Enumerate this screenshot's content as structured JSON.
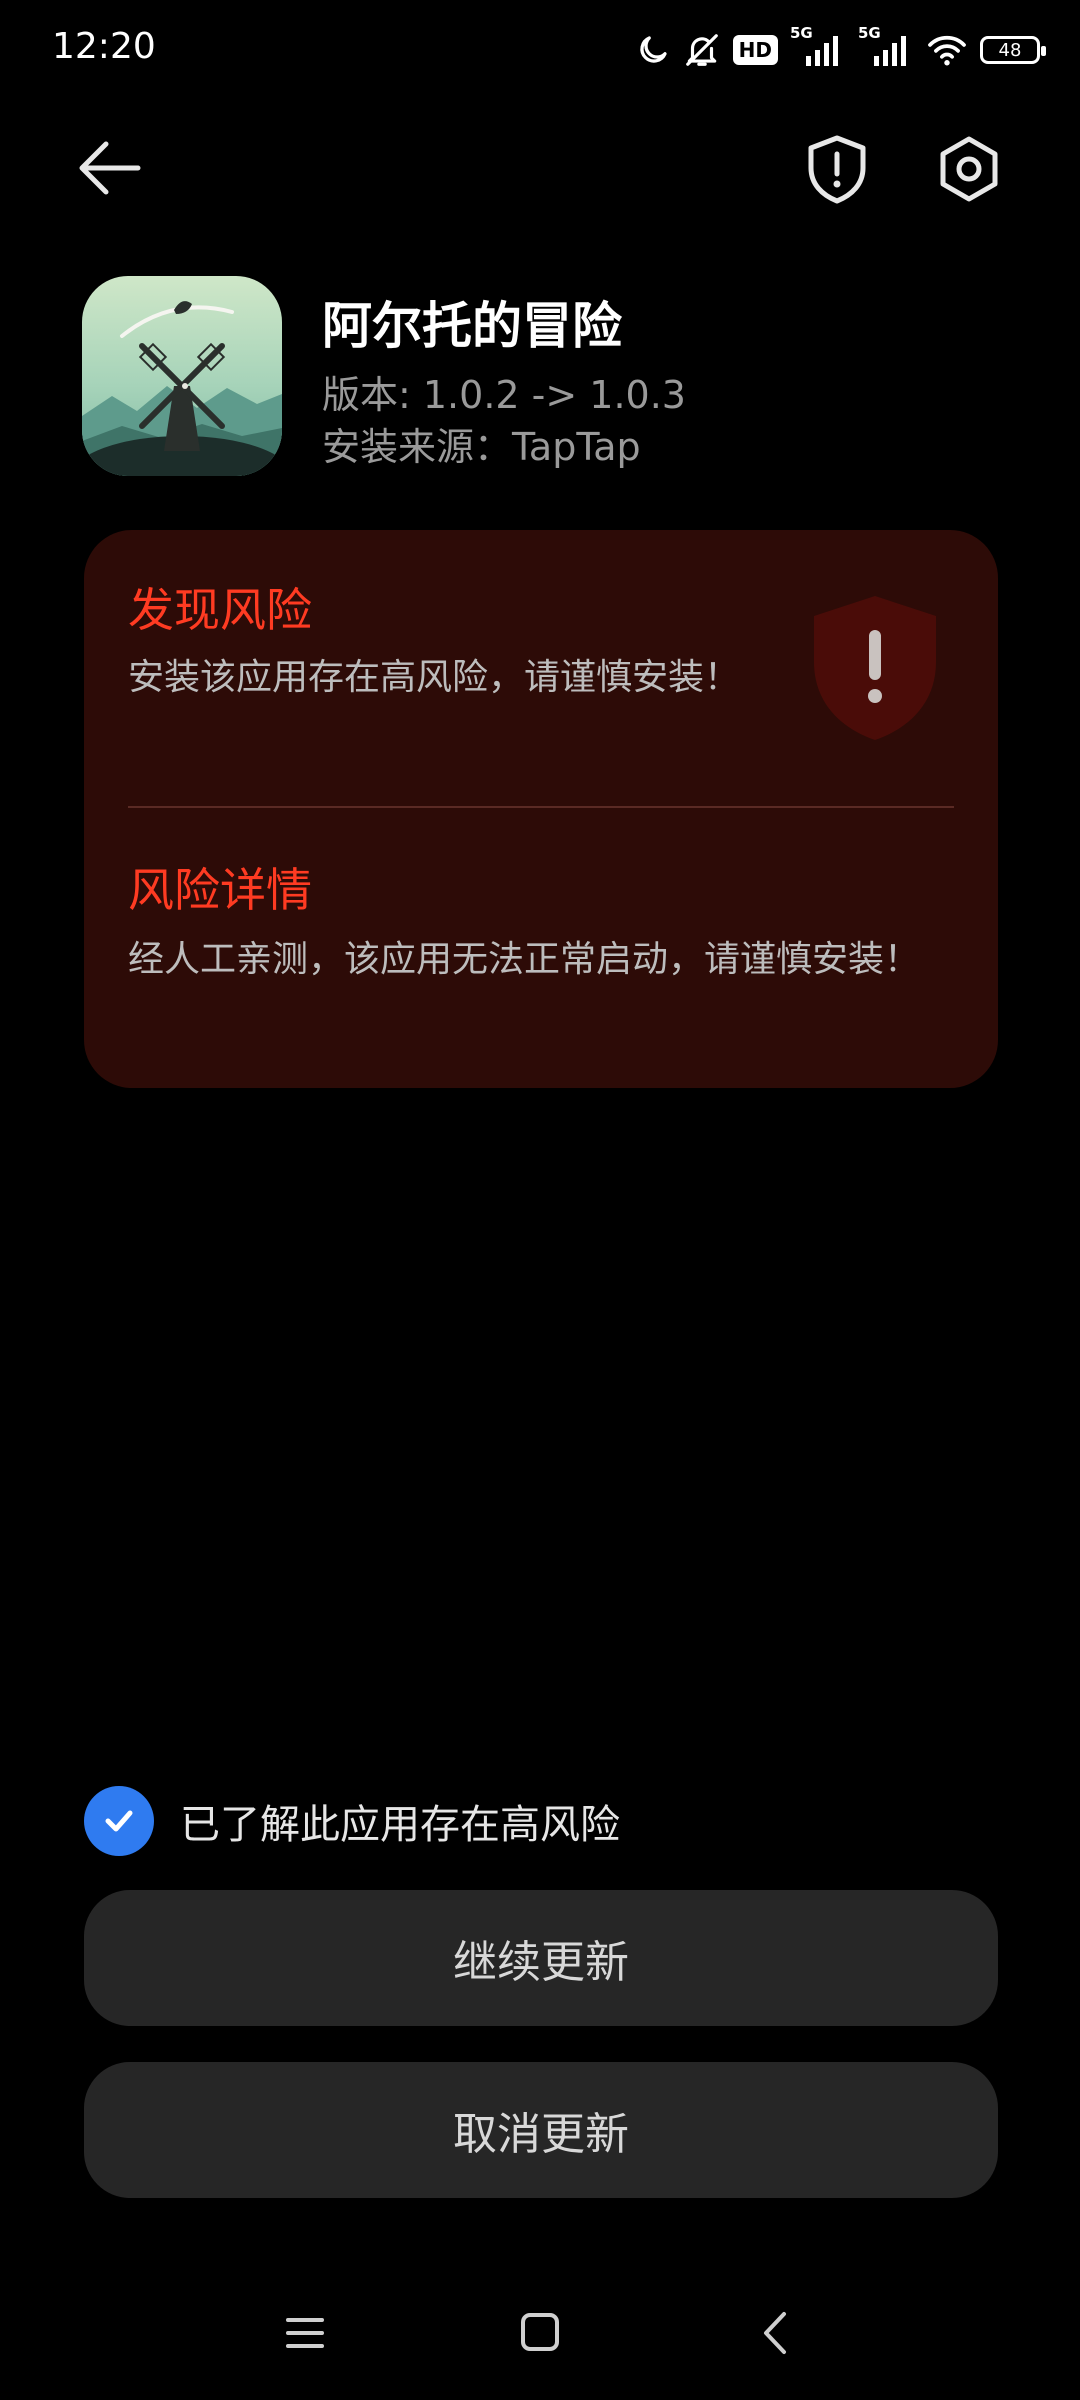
{
  "status_bar": {
    "time": "12:20",
    "hd_badge": "HD",
    "signal1_label": "5G",
    "signal2_label": "5G",
    "battery": "48",
    "icons": [
      "moon-icon",
      "bell-off-icon",
      "hd-icon",
      "signal-icon",
      "signal-icon",
      "wifi-icon",
      "battery-icon"
    ]
  },
  "header": {
    "back_icon": "arrow-left-icon",
    "shield_icon": "shield-alert-icon",
    "settings_icon": "gear-icon"
  },
  "app": {
    "name": "阿尔托的冒险",
    "version": "版本: 1.0.2 -> 1.0.3",
    "source": "安装来源：TapTap",
    "icon": "app-icon-windmill"
  },
  "risk": {
    "title": "发现风险",
    "description": "安装该应用存在高风险，请谨慎安装！",
    "detail_title": "风险详情",
    "detail_description": "经人工亲测，该应用无法正常启动，请谨慎安装！",
    "accent_color": "#ff3b22"
  },
  "acknowledge": {
    "label": "已了解此应用存在高风险",
    "checked": true,
    "color": "#2f7bf0"
  },
  "actions": {
    "continue_label": "继续更新",
    "cancel_label": "取消更新"
  },
  "nav": {
    "menu_icon": "menu-icon",
    "home_icon": "home-icon",
    "back_icon": "chevron-left-icon"
  }
}
